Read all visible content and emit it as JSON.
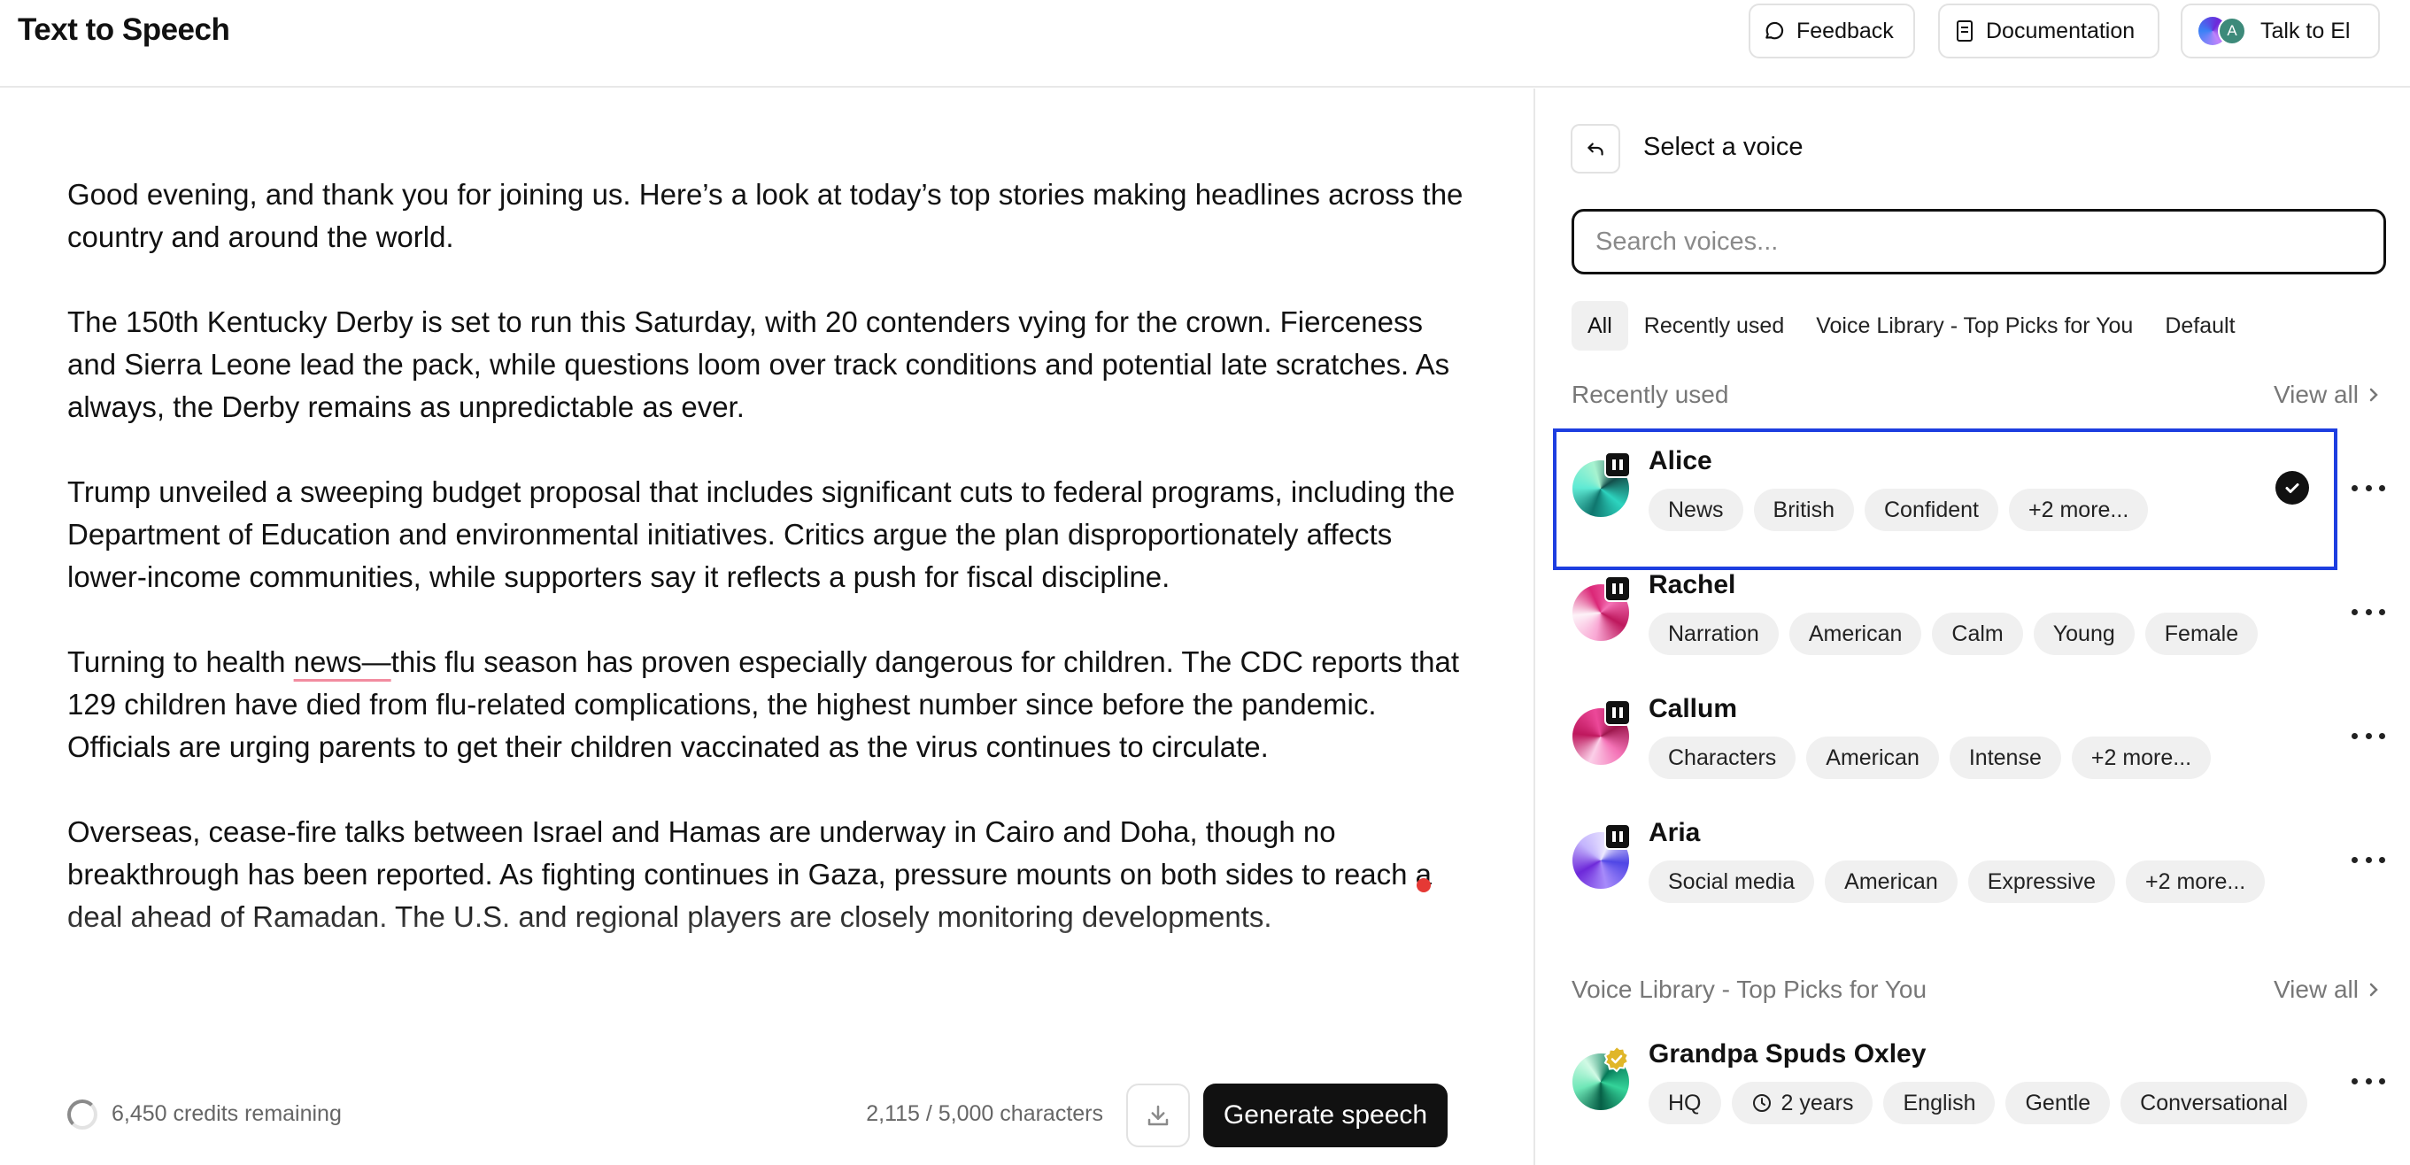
{
  "header": {
    "title": "Text to Speech",
    "feedback_label": "Feedback",
    "documentation_label": "Documentation",
    "talk_label": "Talk to El",
    "talk_avatar_letter": "A"
  },
  "editor": {
    "paragraphs": [
      "Good evening, and thank you for joining us. Here’s a look at today’s top stories making headlines across the country and around the world.",
      "The 150th Kentucky Derby is set to run this Saturday, with 20 contenders vying for the crown. Fierceness and Sierra Leone lead the pack, while questions loom over track conditions and potential late scratches. As always, the Derby remains as unpredictable as ever.",
      "Trump unveiled a sweeping budget proposal that includes significant cuts to federal programs, including the Department of Education and environmental initiatives. Critics argue the plan disproportionately affects lower-income communities, while supporters say it reflects a push for fiscal discipline."
    ],
    "p4_before": "Turning to health ",
    "p4_underlined": "news—",
    "p4_after": "this flu season has proven especially dangerous for children. The CDC reports that 129 children have died from flu-related complications, the highest number since before the pandemic. Officials are urging parents to get their children vaccinated as the virus continues to circulate.",
    "p5": "Overseas, cease-fire talks between Israel and Hamas are underway in Cairo and Doha, though no breakthrough has been reported. As fighting continues in Gaza, pressure mounts on both sides to reach a deal ahead of Ramadan. The U.S. and regional players are closely monitoring developments."
  },
  "footer": {
    "credits": "6,450 credits remaining",
    "char_count": "2,115 / 5,000 characters",
    "generate_label": "Generate speech"
  },
  "sidebar": {
    "title": "Select a voice",
    "search_placeholder": "Search voices...",
    "filters": [
      "All",
      "Recently used",
      "Voice Library - Top Picks for You",
      "Default"
    ],
    "recent_heading": "Recently used",
    "library_heading": "Voice Library - Top Picks for You",
    "view_all": "View all",
    "recent_voices": [
      {
        "name": "Alice",
        "tags": [
          "News",
          "British",
          "Confident",
          "+2 more..."
        ],
        "selected": true
      },
      {
        "name": "Rachel",
        "tags": [
          "Narration",
          "American",
          "Calm",
          "Young",
          "Female"
        ]
      },
      {
        "name": "Callum",
        "tags": [
          "Characters",
          "American",
          "Intense",
          "+2 more..."
        ]
      },
      {
        "name": "Aria",
        "tags": [
          "Social media",
          "American",
          "Expressive",
          "+2 more..."
        ]
      }
    ],
    "library_voices": [
      {
        "name": "Grandpa Spuds Oxley",
        "tags": [
          "HQ",
          "2 years",
          "English",
          "Gentle",
          "Conversational"
        ]
      }
    ]
  },
  "colors": {
    "selection_border": "#1d3ee0",
    "primary_button": "#111111",
    "record_dot": "#e53935"
  }
}
